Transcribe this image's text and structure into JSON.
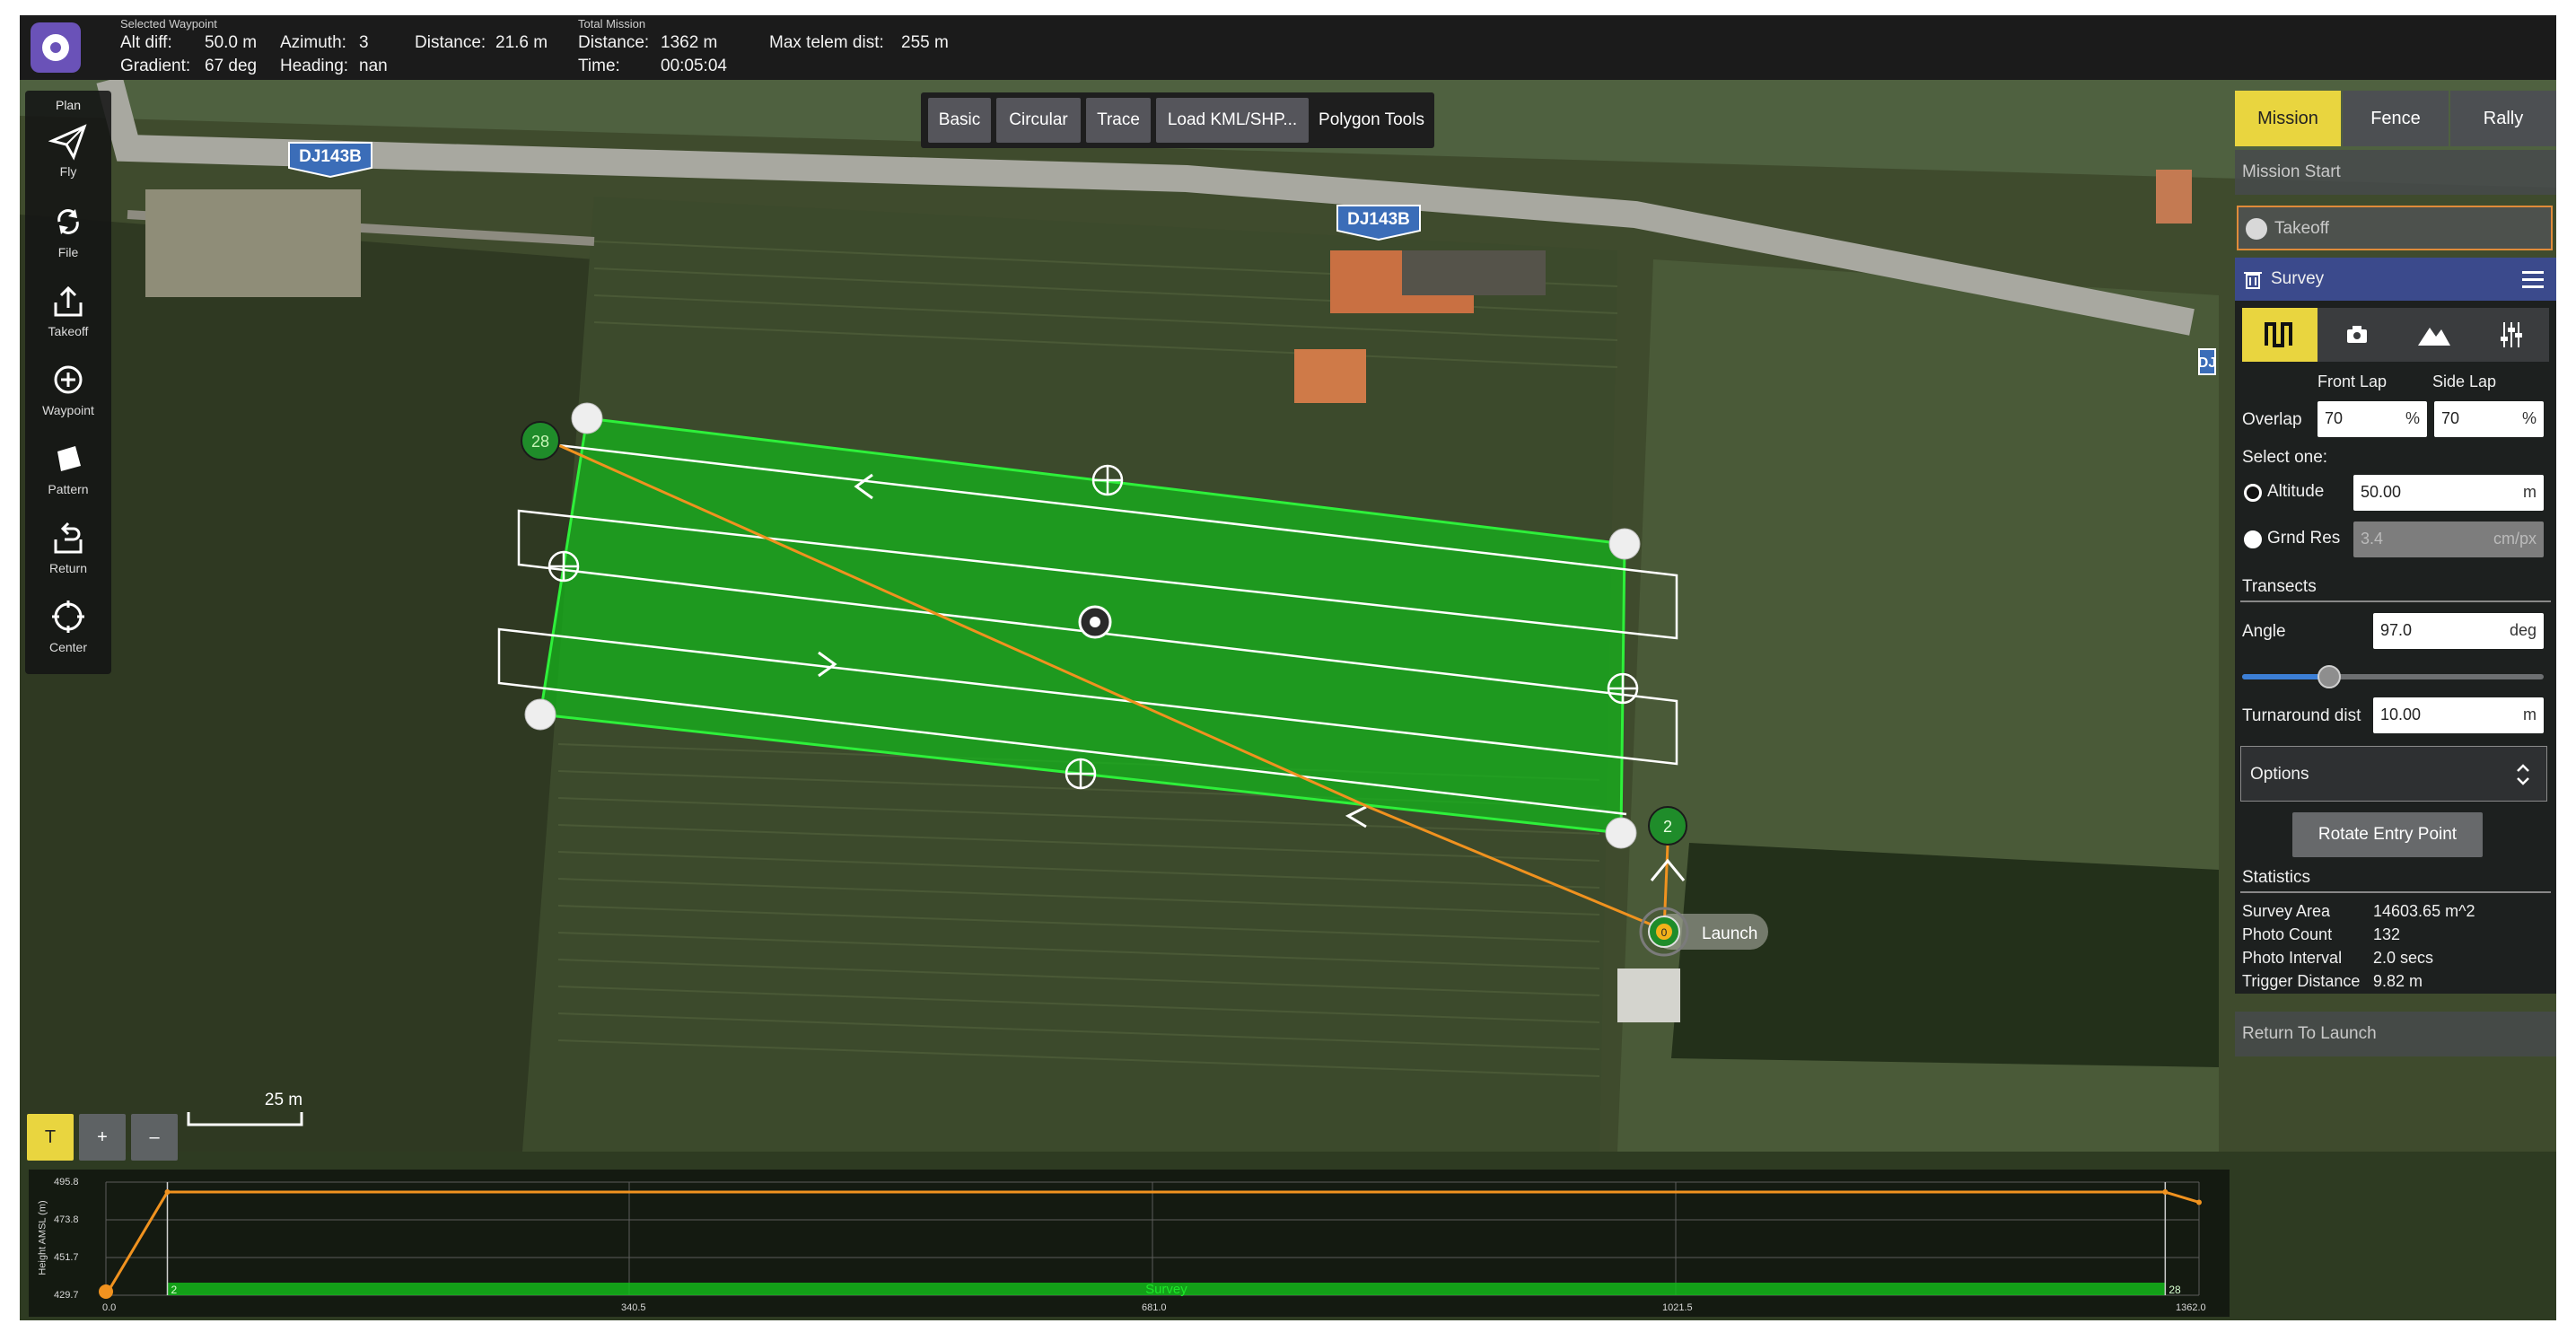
{
  "top_bar": {
    "selected_waypoint_title": "Selected Waypoint",
    "alt_diff_label": "Alt diff:",
    "alt_diff_value": "50.0 m",
    "gradient_label": "Gradient:",
    "gradient_value": "67 deg",
    "azimuth_label": "Azimuth:",
    "azimuth_value": "3",
    "heading_label": "Heading:",
    "heading_value": "nan",
    "distance_label": "Distance:",
    "distance_value": "21.6 m",
    "total_mission_title": "Total Mission",
    "total_distance_label": "Distance:",
    "total_distance_value": "1362 m",
    "time_label": "Time:",
    "time_value": "00:05:04",
    "max_telem_label": "Max telem dist:",
    "max_telem_value": "255 m"
  },
  "left_toolbar": {
    "title": "Plan",
    "buttons": [
      {
        "label": "Fly",
        "icon": "paper-plane-icon"
      },
      {
        "label": "File",
        "icon": "sync-icon"
      },
      {
        "label": "Takeoff",
        "icon": "upload-icon"
      },
      {
        "label": "Waypoint",
        "icon": "plus-circle-icon"
      },
      {
        "label": "Pattern",
        "icon": "pattern-icon"
      },
      {
        "label": "Return",
        "icon": "return-icon"
      },
      {
        "label": "Center",
        "icon": "center-icon"
      }
    ]
  },
  "pattern_toolbar": {
    "buttons": [
      "Basic",
      "Circular",
      "Trace",
      "Load KML/SHP...",
      "Polygon Tools"
    ]
  },
  "map": {
    "road_labels": [
      "DJ143B",
      "DJ143B",
      "DJ"
    ],
    "waypoint_labels": {
      "start": "28",
      "end": "2",
      "launch_index": "0"
    },
    "launch_label": "Launch",
    "scale_label": "25 m"
  },
  "map_controls": {
    "buttons": [
      "T",
      "+",
      "–"
    ]
  },
  "right_panel": {
    "tabs": [
      {
        "label": "Mission",
        "active": true
      },
      {
        "label": "Fence",
        "active": false
      },
      {
        "label": "Rally",
        "active": false
      }
    ],
    "mission_start_label": "Mission Start",
    "takeoff_label": "Takeoff",
    "survey_label": "Survey",
    "mode_icons": [
      "transects-icon",
      "camera-icon",
      "terrain-icon",
      "sliders-icon"
    ],
    "front_lap_label": "Front Lap",
    "side_lap_label": "Side Lap",
    "overlap_label": "Overlap",
    "front_lap_value": "70",
    "side_lap_value": "70",
    "percent_unit": "%",
    "select_one_label": "Select one:",
    "altitude_label": "Altitude",
    "altitude_value": "50.00",
    "altitude_unit": "m",
    "grnd_res_label": "Grnd Res",
    "grnd_res_value": "3.4",
    "grnd_res_unit": "cm/px",
    "transects_label": "Transects",
    "angle_label": "Angle",
    "angle_value": "97.0",
    "angle_unit": "deg",
    "angle_slider_fraction": 0.29,
    "turnaround_label": "Turnaround dist",
    "turnaround_value": "10.00",
    "turnaround_unit": "m",
    "options_label": "Options",
    "rotate_entry_label": "Rotate Entry Point",
    "statistics_label": "Statistics",
    "stats": [
      {
        "label": "Survey Area",
        "value": "14603.65 m^2"
      },
      {
        "label": "Photo Count",
        "value": "132"
      },
      {
        "label": "Photo Interval",
        "value": "2.0 secs"
      },
      {
        "label": "Trigger Distance",
        "value": "9.82 m"
      }
    ],
    "return_to_launch_label": "Return To Launch"
  },
  "colors": {
    "accent": "#e9d53f",
    "survey_fill": "#13b81a",
    "flight_path": "#f0921f",
    "panel_header": "#3b4a8c",
    "active_tab_text": "#222222"
  },
  "chart_data": {
    "type": "line",
    "title": "",
    "ylabel": "Height AMSL (m)",
    "ytick_labels": [
      "495.8",
      "473.8",
      "451.7",
      "429.7"
    ],
    "xtick_labels": [
      "0.0",
      "340.5",
      "681.0",
      "1021.5",
      "1362.0"
    ],
    "ylim": [
      429.7,
      495.8
    ],
    "xlim": [
      0,
      1362
    ],
    "series": [
      {
        "x": [
          0,
          40,
          1340,
          1362
        ],
        "y": [
          429.7,
          490,
          490,
          484
        ]
      }
    ],
    "survey_segment_label": "Survey",
    "survey_range": [
      40,
      1340
    ],
    "segment_markers": [
      "2",
      "28"
    ]
  }
}
